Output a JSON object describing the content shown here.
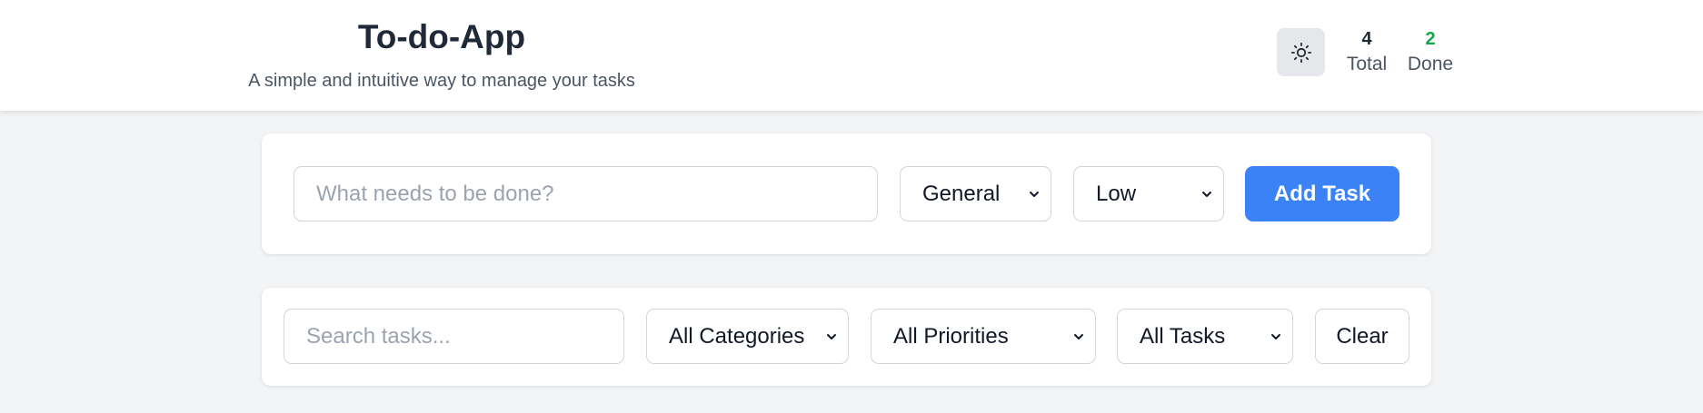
{
  "header": {
    "title": "To-do-App",
    "subtitle": "A simple and intuitive way to manage your tasks",
    "theme_icon": "sun-icon",
    "stats": {
      "total_value": "4",
      "total_label": "Total",
      "done_value": "2",
      "done_label": "Done"
    }
  },
  "add_form": {
    "task_placeholder": "What needs to be done?",
    "category_value": "General",
    "priority_value": "Low",
    "add_label": "Add Task"
  },
  "filters": {
    "search_placeholder": "Search tasks...",
    "category_value": "All Categories",
    "priority_value": "All Priorities",
    "status_value": "All Tasks",
    "clear_label": "Clear"
  },
  "colors": {
    "accent": "#3b82f6",
    "done_green": "#16a34a",
    "background": "#f3f4f6"
  }
}
